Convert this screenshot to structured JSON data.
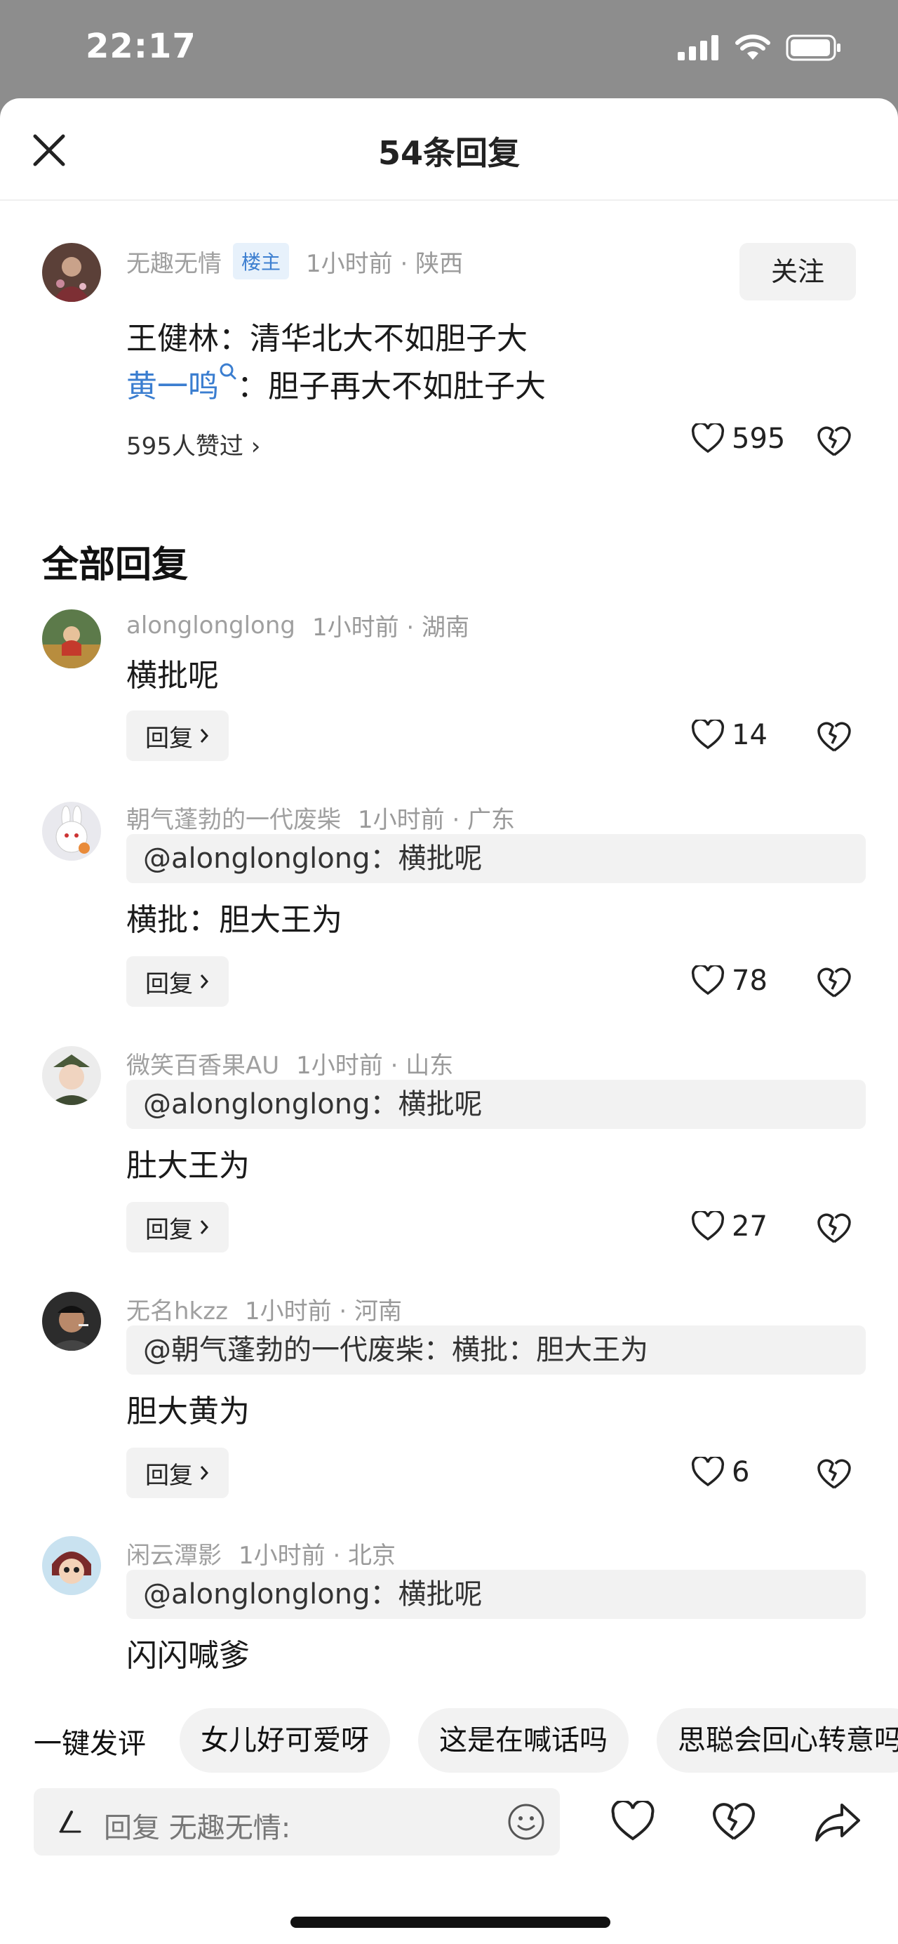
{
  "status_bar": {
    "time": "22:17"
  },
  "header": {
    "title": "54条回复"
  },
  "main_comment": {
    "author": "无趣无情",
    "badge": "楼主",
    "time_location": "1小时前 · 陕西",
    "follow_label": "关注",
    "line1": "王健林：清华北大不如胆子大",
    "mention": "黄一鸣",
    "line2_rest": "：胆子再大不如肚子大",
    "likers": "595人赞过 ›",
    "likes": "595"
  },
  "section_title": "全部回复",
  "replies": [
    {
      "author": "alonglonglong",
      "time_location": "1小时前 · 湖南",
      "quote": "",
      "text": "横批呢",
      "reply_label": "回复",
      "likes": "14"
    },
    {
      "author": "朝气蓬勃的一代废柴",
      "time_location": "1小时前 · 广东",
      "quote": "@alonglonglong：横批呢",
      "text": "横批：胆大王为",
      "reply_label": "回复",
      "likes": "78"
    },
    {
      "author": "微笑百香果AU",
      "time_location": "1小时前 · 山东",
      "quote": "@alonglonglong：横批呢",
      "text": "肚大王为",
      "reply_label": "回复",
      "likes": "27"
    },
    {
      "author": "无名hkzz",
      "time_location": "1小时前 · 河南",
      "quote": "@朝气蓬勃的一代废柴：横批：胆大王为",
      "text": "胆大黄为",
      "reply_label": "回复",
      "likes": "6"
    },
    {
      "author": "闲云潭影",
      "time_location": "1小时前 · 北京",
      "quote": "@alonglonglong：横批呢",
      "text": "闪闪喊爹",
      "reply_label": "",
      "likes": ""
    }
  ],
  "quick_replies": {
    "label": "一键发评",
    "chips": [
      "女儿好可爱呀",
      "这是在喊话吗",
      "思聪会回心转意吗"
    ]
  },
  "input": {
    "placeholder": "回复 无趣无情:"
  }
}
